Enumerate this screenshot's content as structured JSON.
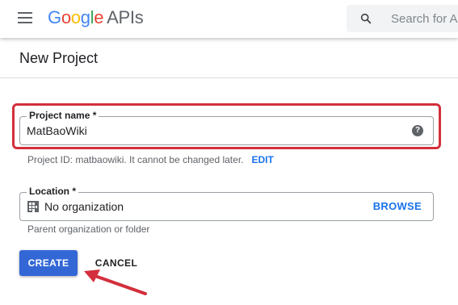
{
  "header": {
    "menu_icon": "hamburger-menu-icon",
    "logo_brand": "Google",
    "logo_brand_colors": [
      "#4285F4",
      "#EA4335",
      "#FBBC05",
      "#4285F4",
      "#34A853",
      "#EA4335"
    ],
    "logo_product": "APIs",
    "search_icon": "search-icon",
    "search_placeholder": "Search for APIs and Services"
  },
  "page": {
    "title": "New Project"
  },
  "project_name": {
    "label": "Project name *",
    "value": "MatBaoWiki",
    "help_icon": "help-icon",
    "help_glyph": "?",
    "highlight_color": "#D32F3C",
    "hint": "Project ID: matbaowiki. It cannot be changed later.",
    "edit_label": "EDIT"
  },
  "location": {
    "label": "Location *",
    "icon": "organization-icon",
    "value": "No organization",
    "browse_label": "BROWSE",
    "hint": "Parent organization or folder"
  },
  "actions": {
    "create_label": "CREATE",
    "cancel_label": "CANCEL",
    "annotation_arrow_color": "#D32F3C"
  },
  "colors": {
    "accent": "#3367D6",
    "link": "#1A73E8"
  }
}
